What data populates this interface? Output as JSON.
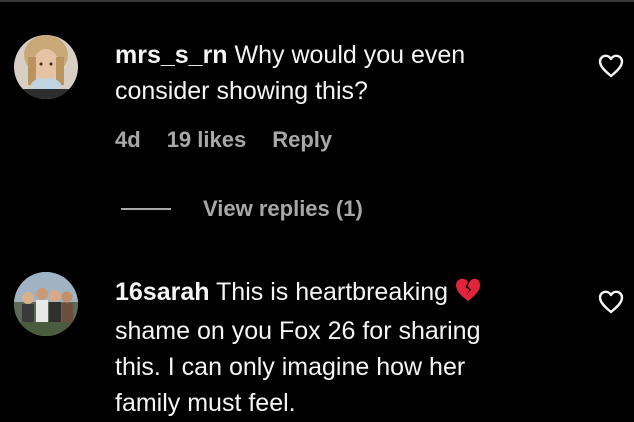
{
  "comments": [
    {
      "username": "mrs_s_rn",
      "text_line1": " Why would you even",
      "text_line2": "consider showing this?",
      "age": "4d",
      "likes": "19 likes",
      "reply_label": "Reply",
      "view_replies_label": "View replies (1)"
    },
    {
      "username": "16sarah",
      "text_line1": " This is heartbreaking",
      "text_line2": "shame on you Fox 26 for sharing",
      "text_line3": "this. I can only imagine how her",
      "text_line4": "family must feel.",
      "emoji": "broken-heart"
    }
  ],
  "icons": {
    "like": "heart-outline-icon",
    "emoji": "broken-heart-emoji-icon"
  },
  "colors": {
    "background": "#000000",
    "text": "#f5f5f5",
    "secondary_text": "#a8a8a8",
    "emoji_red": "#e0243a"
  }
}
